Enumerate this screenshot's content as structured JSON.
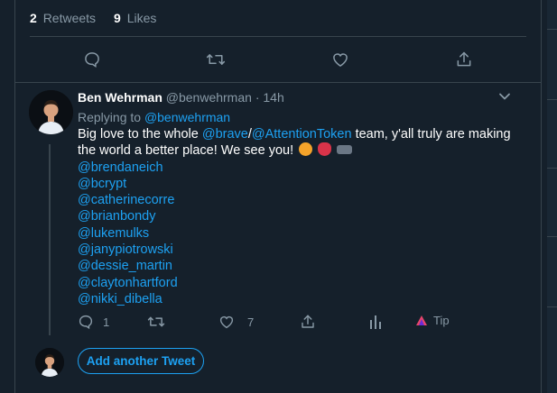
{
  "stats": {
    "retweets_count": "2",
    "retweets_label": "Retweets",
    "likes_count": "9",
    "likes_label": "Likes"
  },
  "reply": {
    "author_name": "Ben Wehrman",
    "author_handle": "@benwehrman",
    "separator": "·",
    "time": "14h",
    "replying_prefix": "Replying to",
    "replying_to": "@benwehrman",
    "text_part1": "Big love to the whole",
    "mention_brave": "@brave",
    "slash": "/",
    "mention_attention": "@AttentionToken",
    "text_part2": "team, y'all truly are making",
    "text_line2": "the world a better place! We see you!",
    "emojis": [
      "lion-emoji",
      "heart-emoji",
      "bat-emoji"
    ],
    "mentions": [
      "@brendaneich",
      "@bcrypt",
      "@catherinecorre",
      "@brianbondy",
      "@lukemulks",
      "@janypiotrowski",
      "@dessie_martin",
      "@claytonhartford",
      "@nikki_dibella"
    ],
    "reply_count": "1",
    "like_count": "7",
    "tip_label": "Tip"
  },
  "compose": {
    "add_button_label": "Add another Tweet"
  },
  "icons": {
    "reply": "reply-icon",
    "retweet": "retweet-icon",
    "like": "heart-icon",
    "share": "share-icon",
    "analytics": "analytics-icon",
    "tip": "brave-tip-icon",
    "chevron": "chevron-down-icon"
  },
  "colors": {
    "background": "#15202b",
    "accent": "#1da1f2",
    "muted": "#8899a6",
    "border": "#38444d"
  }
}
